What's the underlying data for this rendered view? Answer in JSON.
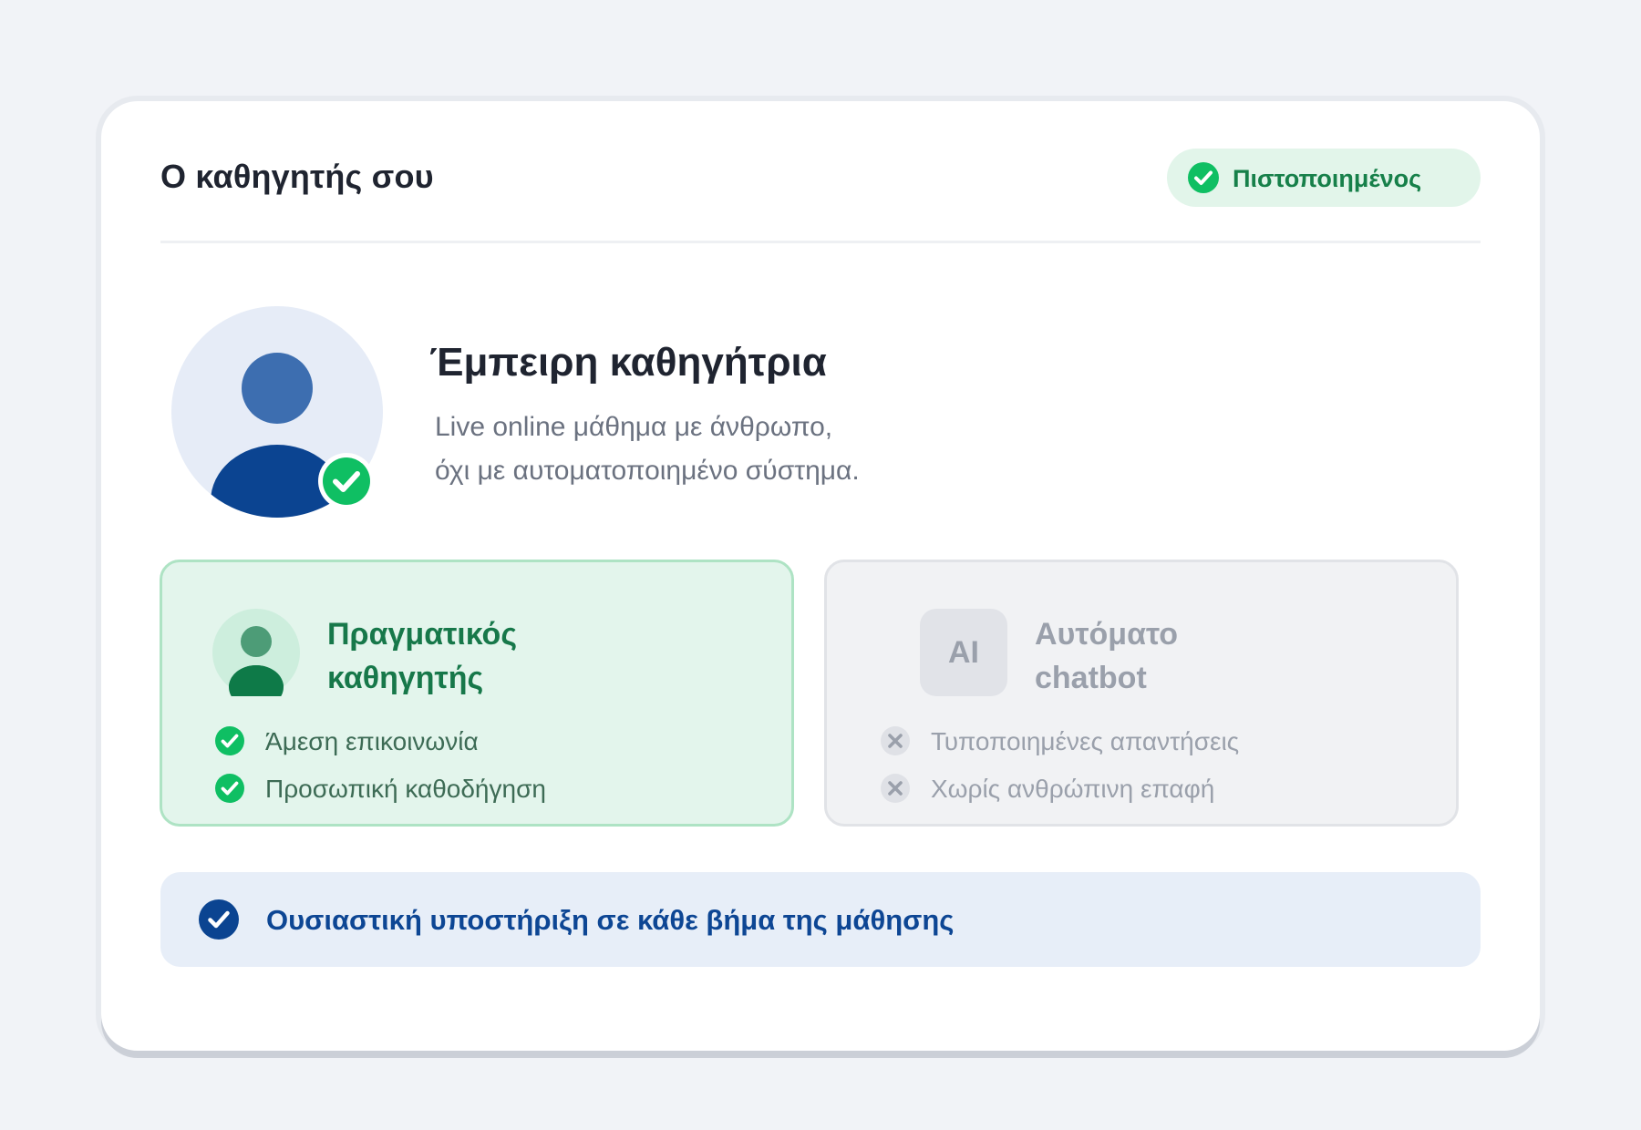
{
  "colors": {
    "page_bg": "#f1f3f7",
    "card_bg": "#ffffff",
    "primary_dark": "#0b4491",
    "success_green": "#0fbf63",
    "human_panel_bg": "#e3f5ec",
    "bot_panel_bg": "#f1f2f4",
    "support_bg": "#e7eef8"
  },
  "header": {
    "title": "Ο καθηγητής σου",
    "badge": {
      "label": "Πιστοποιημένος",
      "icon": "check-circle-icon"
    }
  },
  "profile": {
    "avatar_icon": "person-avatar-icon",
    "avatar_badge_icon": "verified-check-icon",
    "title": "Έμπειρη καθηγήτρια",
    "description_lines": [
      "Live online μάθημα με άνθρωπο,",
      "όχι με αυτοματοποιημένο σύστημα."
    ]
  },
  "comparison": {
    "human": {
      "icon": "person-icon",
      "heading_lines": [
        "Πραγματικός",
        "καθηγητής"
      ],
      "features": [
        {
          "label": "Άμεση επικοινωνία",
          "icon": "check-circle-icon"
        },
        {
          "label": "Προσωπική καθοδήγηση",
          "icon": "check-circle-icon"
        }
      ]
    },
    "bot": {
      "icon_text": "AI",
      "heading_lines": [
        "Αυτόματο",
        "chatbot"
      ],
      "features": [
        {
          "label": "Τυποποιημένες απαντήσεις",
          "icon": "x-circle-icon"
        },
        {
          "label": "Χωρίς ανθρώπινη επαφή",
          "icon": "x-circle-icon"
        }
      ]
    }
  },
  "support": {
    "label": "Ουσιαστική υποστήριξη σε κάθε βήμα της μάθησης",
    "icon": "check-circle-icon"
  }
}
